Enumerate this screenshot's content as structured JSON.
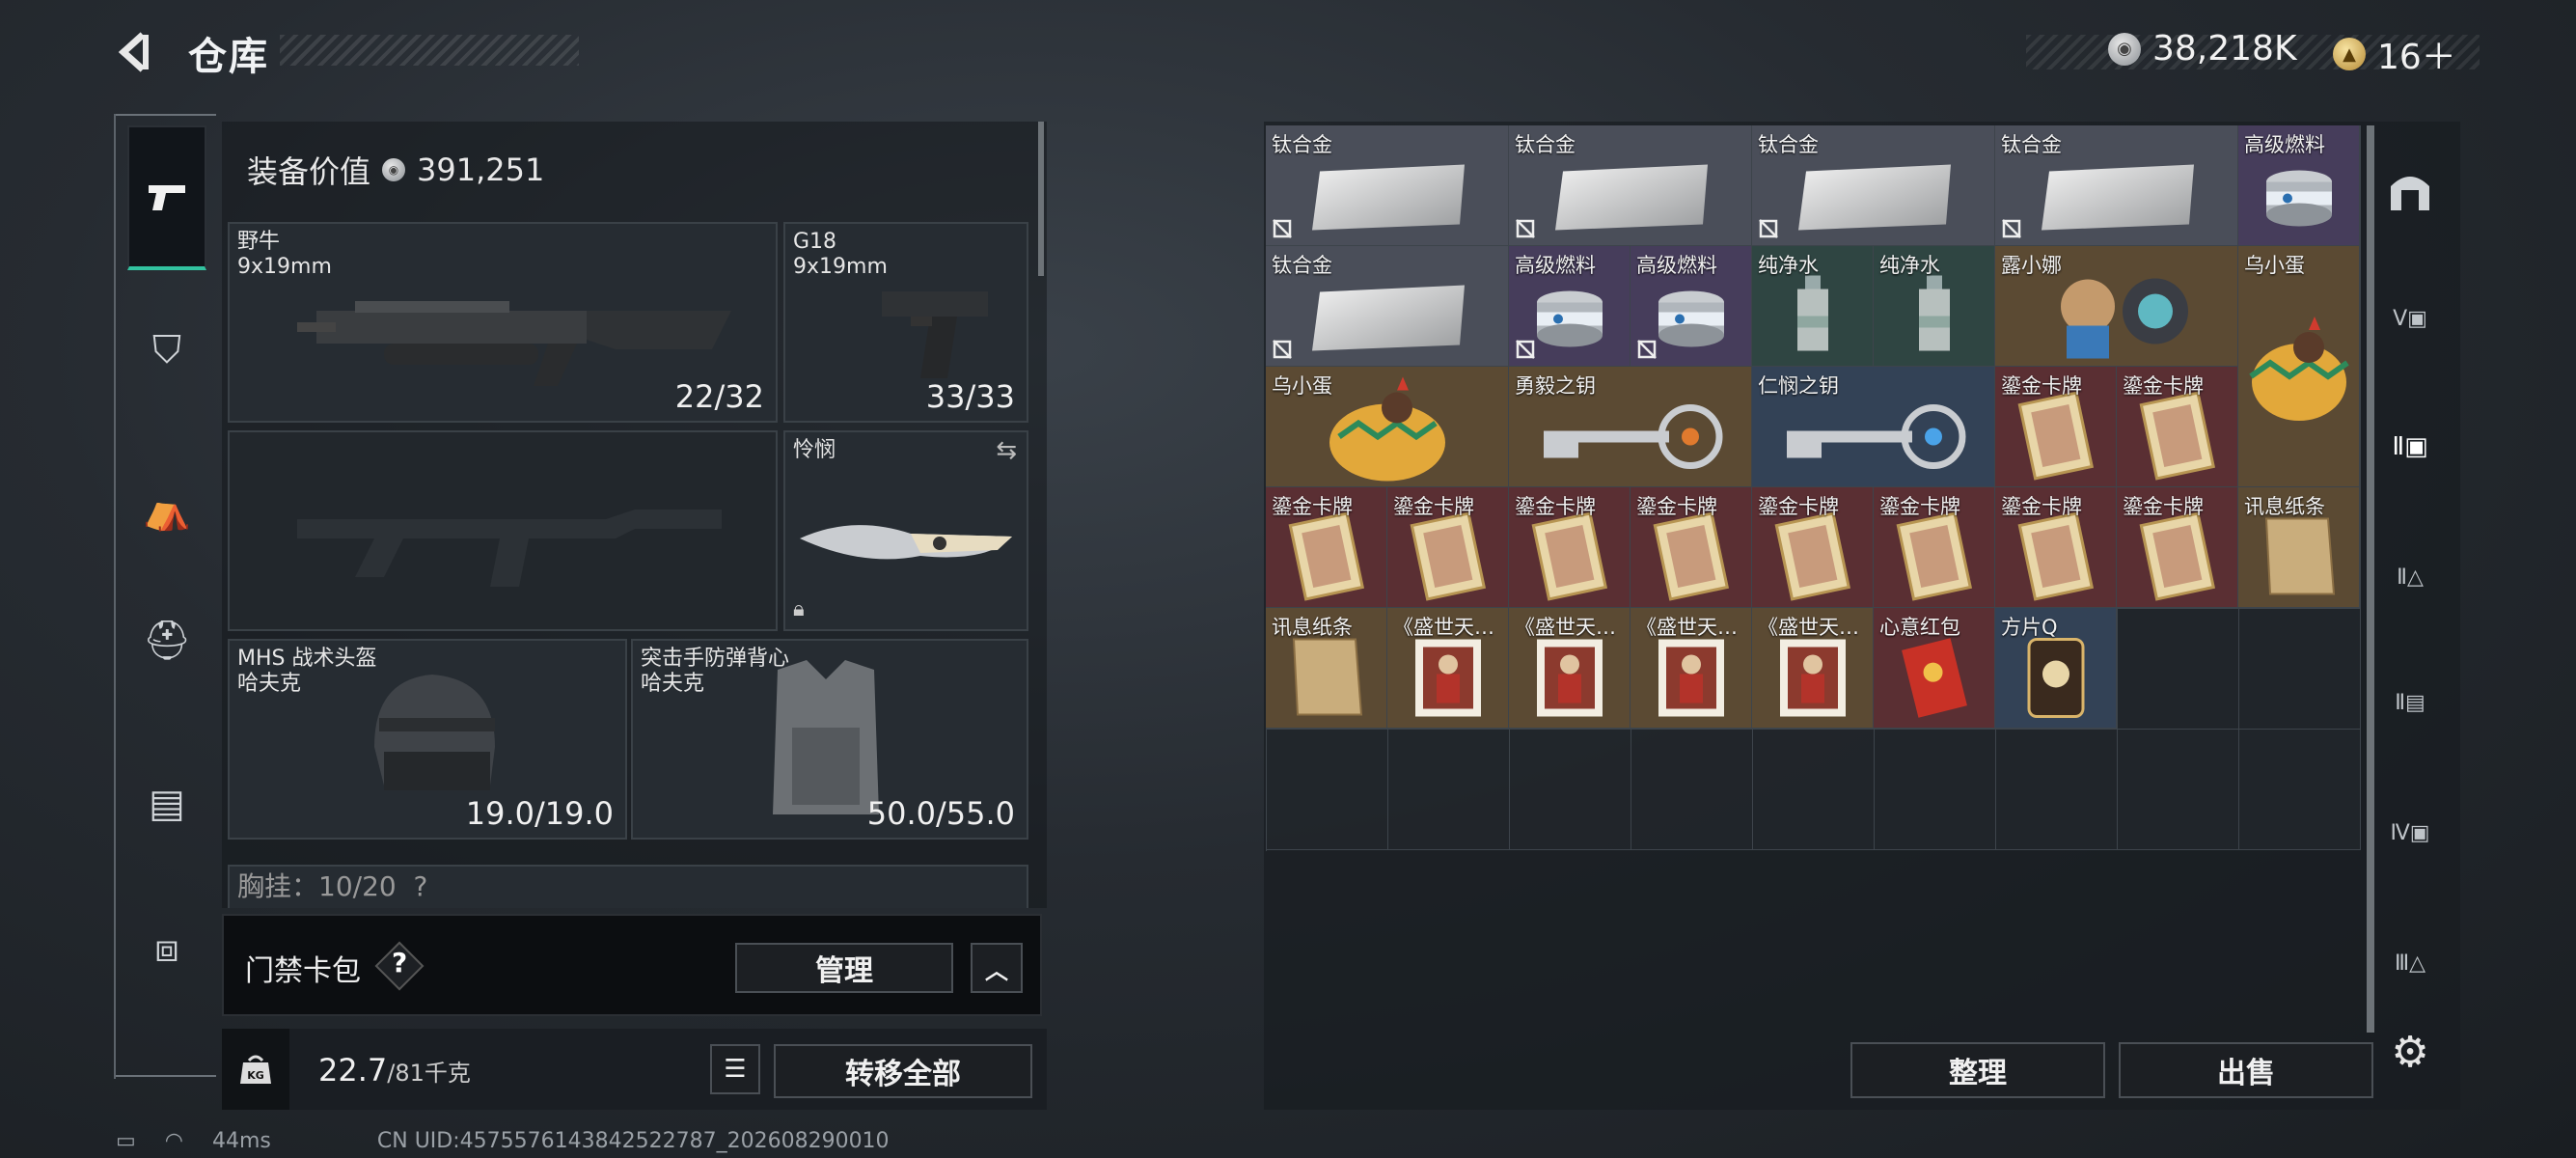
{
  "header": {
    "title": "仓库",
    "currency_silver": "38,218K",
    "currency_gold": "16＋"
  },
  "equipment": {
    "value_label": "装备价值",
    "value": "391,251",
    "primary_weapon": {
      "name": "野牛",
      "caliber": "9x19mm",
      "ammo": "22/32"
    },
    "secondary_weapon": {
      "name": "G18",
      "caliber": "9x19mm",
      "ammo": "33/33"
    },
    "melee": {
      "name": "怜悯"
    },
    "helmet": {
      "name": "MHS 战术头盔",
      "brand": "哈夫克",
      "durability": "19.0/19.0"
    },
    "armor": {
      "name": "突击手防弹背心",
      "brand": "哈夫克",
      "durability": "50.0/55.0"
    },
    "chest_rig_partial": "胸挂：10/20  ?"
  },
  "keycard": {
    "label": "门禁卡包",
    "help": "?",
    "manage_label": "管理"
  },
  "weight": {
    "current": "22.7",
    "max": "/81千克"
  },
  "transfer_all_label": "转移全部",
  "sort_label": "整理",
  "sell_label": "出售",
  "status_bar": {
    "ping": "44ms",
    "uid": "CN UID:4575576143842522787_202608290010"
  },
  "items": [
    {
      "name": "钛合金",
      "kind": "ingot",
      "bg": "gray",
      "locked": true
    },
    {
      "name": "钛合金",
      "kind": "ingot",
      "bg": "gray",
      "locked": true
    },
    {
      "name": "钛合金",
      "kind": "ingot",
      "bg": "gray",
      "locked": true
    },
    {
      "name": "钛合金",
      "kind": "ingot",
      "bg": "gray",
      "locked": true
    },
    {
      "name": "高级燃料",
      "kind": "can",
      "bg": "purple",
      "locked": false
    },
    {
      "name": "钛合金",
      "kind": "ingot",
      "bg": "gray",
      "locked": true
    },
    {
      "name": "高级燃料",
      "kind": "can",
      "bg": "purple",
      "locked": true
    },
    {
      "name": "高级燃料",
      "kind": "can",
      "bg": "purple",
      "locked": true
    },
    {
      "name": "纯净水",
      "kind": "bottle",
      "bg": "green",
      "locked": false
    },
    {
      "name": "纯净水",
      "kind": "bottle",
      "bg": "green",
      "locked": false
    },
    {
      "name": "露小娜",
      "kind": "doll",
      "bg": "gold",
      "locked": false
    },
    {
      "name": "乌小蛋",
      "kind": "egg",
      "bg": "gold",
      "locked": false
    },
    {
      "name": "乌小蛋",
      "kind": "egg",
      "bg": "gold",
      "locked": false
    },
    {
      "name": "勇毅之钥",
      "kind": "key",
      "bg": "gold",
      "locked": false
    },
    {
      "name": "仁悯之钥",
      "kind": "key-blue",
      "bg": "blue",
      "locked": false
    },
    {
      "name": "鎏金卡牌",
      "kind": "card",
      "bg": "red",
      "locked": false
    },
    {
      "name": "鎏金卡牌",
      "kind": "card",
      "bg": "red",
      "locked": false
    },
    {
      "name": "鎏金卡牌",
      "kind": "card",
      "bg": "red",
      "locked": false
    },
    {
      "name": "鎏金卡牌",
      "kind": "card",
      "bg": "red",
      "locked": false
    },
    {
      "name": "鎏金卡牌",
      "kind": "card",
      "bg": "red",
      "locked": false
    },
    {
      "name": "鎏金卡牌",
      "kind": "card",
      "bg": "red",
      "locked": false
    },
    {
      "name": "鎏金卡牌",
      "kind": "card",
      "bg": "red",
      "locked": false
    },
    {
      "name": "鎏金卡牌",
      "kind": "card",
      "bg": "red",
      "locked": false
    },
    {
      "name": "鎏金卡牌",
      "kind": "card",
      "bg": "red",
      "locked": false
    },
    {
      "name": "鎏金卡牌",
      "kind": "card",
      "bg": "red",
      "locked": false
    },
    {
      "name": "讯息纸条",
      "kind": "paper",
      "bg": "gold",
      "locked": false
    },
    {
      "name": "讯息纸条",
      "kind": "paper",
      "bg": "gold",
      "locked": false
    },
    {
      "name": "《盛世天…",
      "kind": "painting",
      "bg": "gold",
      "locked": false
    },
    {
      "name": "《盛世天…",
      "kind": "painting",
      "bg": "gold",
      "locked": false
    },
    {
      "name": "《盛世天…",
      "kind": "painting",
      "bg": "gold",
      "locked": false
    },
    {
      "name": "《盛世天…",
      "kind": "painting",
      "bg": "gold",
      "locked": false
    },
    {
      "name": "心意红包",
      "kind": "envelope",
      "bg": "red",
      "locked": false
    },
    {
      "name": "方片Q",
      "kind": "tarot",
      "bg": "blue",
      "locked": false
    }
  ],
  "icons": {
    "back": "chevron-left-icon",
    "silver_coin": "silver-coin-icon",
    "gold_coin": "gold-coin-icon",
    "settings": "gear-icon"
  }
}
